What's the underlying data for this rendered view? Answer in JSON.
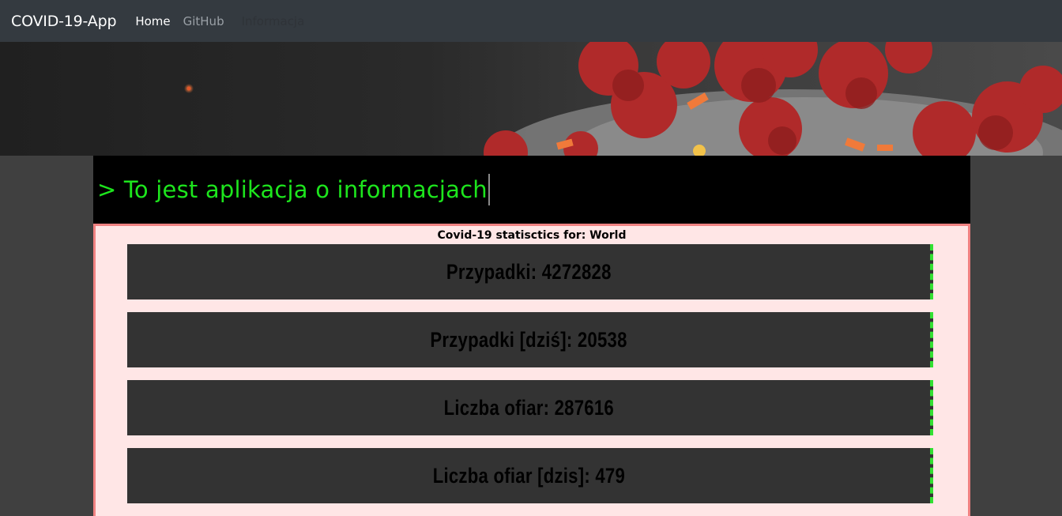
{
  "navbar": {
    "brand": "COVID-19-App",
    "links": [
      {
        "label": "Home"
      },
      {
        "label": "GitHub"
      },
      {
        "label": "Informacja"
      }
    ]
  },
  "terminal": {
    "text": "> To jest aplikacja o informacjach"
  },
  "stats": {
    "title": "Covid-19 statisctics for: World",
    "cards": [
      {
        "text": "Przypadki: 4272828"
      },
      {
        "text": "Przypadki [dziś]: 20538"
      },
      {
        "text": "Liczba ofiar: 287616"
      },
      {
        "text": "Liczba ofiar [dzis]: 479"
      }
    ]
  },
  "colors": {
    "navbar": "#343a40",
    "terminal_text": "#1de51d",
    "panel_bg": "#ffe6e6",
    "panel_border": "#f08282",
    "card_bg": "#333333",
    "card_border": "#32e032"
  },
  "icons": {
    "hero": "coronavirus-image"
  }
}
